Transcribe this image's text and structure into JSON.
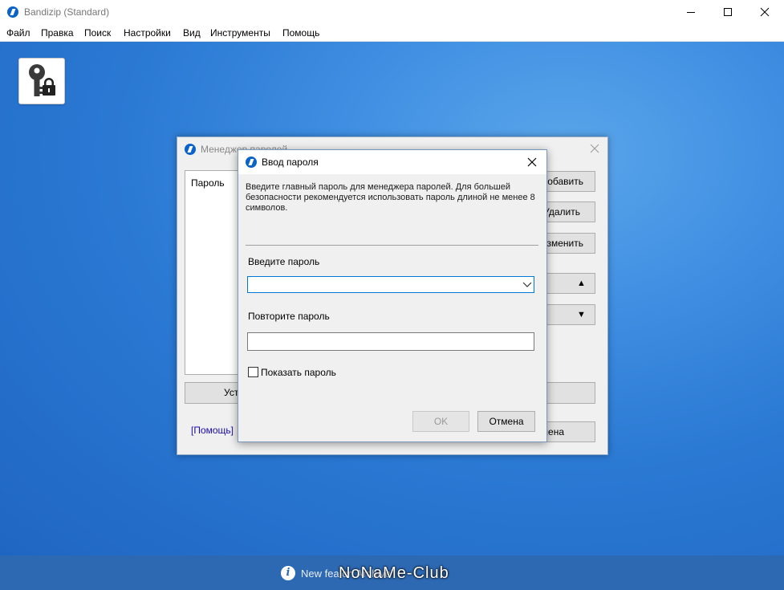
{
  "window": {
    "title": "Bandizip (Standard)"
  },
  "menu": [
    "Файл",
    "Правка",
    "Поиск",
    "Настройки",
    "Вид",
    "Инструменты",
    "Помощь"
  ],
  "password_manager": {
    "title": "Менеджер паролей",
    "list_header": "Пароль",
    "buttons": {
      "add": "Добавить",
      "delete": "Удалить",
      "edit": "Изменить",
      "up": "▲",
      "down": "▼",
      "set": "Уст",
      "cancel": "мена"
    },
    "help_link": "[Помощь]"
  },
  "dialog": {
    "title": "Ввод пароля",
    "description": "Введите главный пароль для менеджера паролей. Для большей безопасности рекомендуется использовать пароль длиной не менее 8 символов.",
    "enter_label": "Введите пароль",
    "enter_value": "",
    "repeat_label": "Повторите пароль",
    "repeat_value": "",
    "show_password_label": "Показать пароль",
    "show_password_checked": false,
    "ok_label": "OK",
    "cancel_label": "Отмена"
  },
  "status": {
    "text": "New fea                              on Archive\""
  },
  "watermark": "NoNaMe-Club",
  "colors": {
    "accent": "#0078d7",
    "desktop": "#2a79d3",
    "statusbar": "#2d69b3"
  },
  "icons": {
    "tool": "key-lock-icon",
    "info": "info-icon"
  }
}
